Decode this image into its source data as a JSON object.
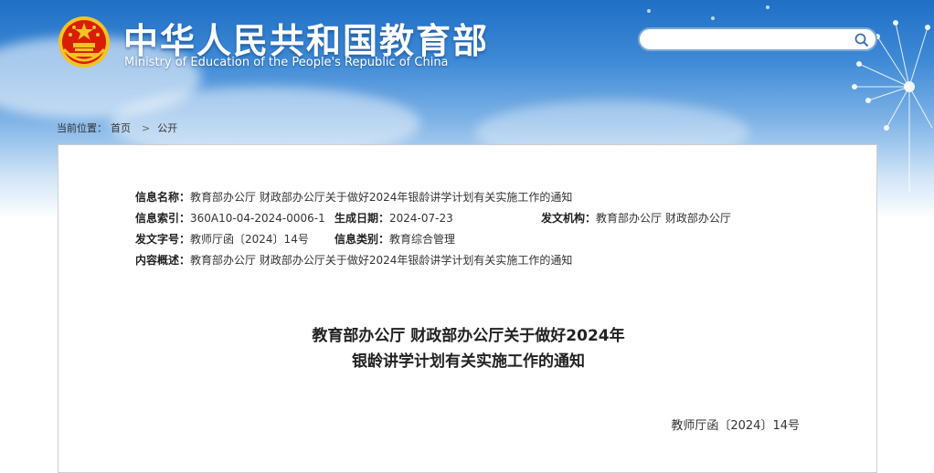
{
  "header": {
    "title": "中华人民共和国教育部",
    "subtitle": "Ministry of Education of the People's Republic of China",
    "search": {
      "placeholder": "",
      "value": ""
    }
  },
  "breadcrumb": {
    "prefix": "当前位置：",
    "items": [
      "首页",
      "公开"
    ],
    "separator": ">"
  },
  "info": {
    "name_label": "信息名称：",
    "name_value": "教育部办公厅 财政部办公厅关于做好2024年银龄讲学计划有关实施工作的通知",
    "index_label": "信息索引：",
    "index_value": "360A10-04-2024-0006-1",
    "date_label": "生成日期：",
    "date_value": "2024-07-23",
    "org_label": "发文机构：",
    "org_value": "教育部办公厅 财政部办公厅",
    "docno_label": "发文字号：",
    "docno_value": "教师厅函〔2024〕14号",
    "category_label": "信息类别：",
    "category_value": "教育综合管理",
    "summary_label": "内容概述：",
    "summary_value": "教育部办公厅 财政部办公厅关于做好2024年银龄讲学计划有关实施工作的通知"
  },
  "document": {
    "title_line1": "教育部办公厅 财政部办公厅关于做好2024年",
    "title_line2": "银龄讲学计划有关实施工作的通知",
    "number": "教师厅函〔2024〕14号"
  },
  "colors": {
    "sky_top": "#1f6fc6",
    "emblem_red": "#d81e06",
    "emblem_gold": "#f6c223"
  }
}
